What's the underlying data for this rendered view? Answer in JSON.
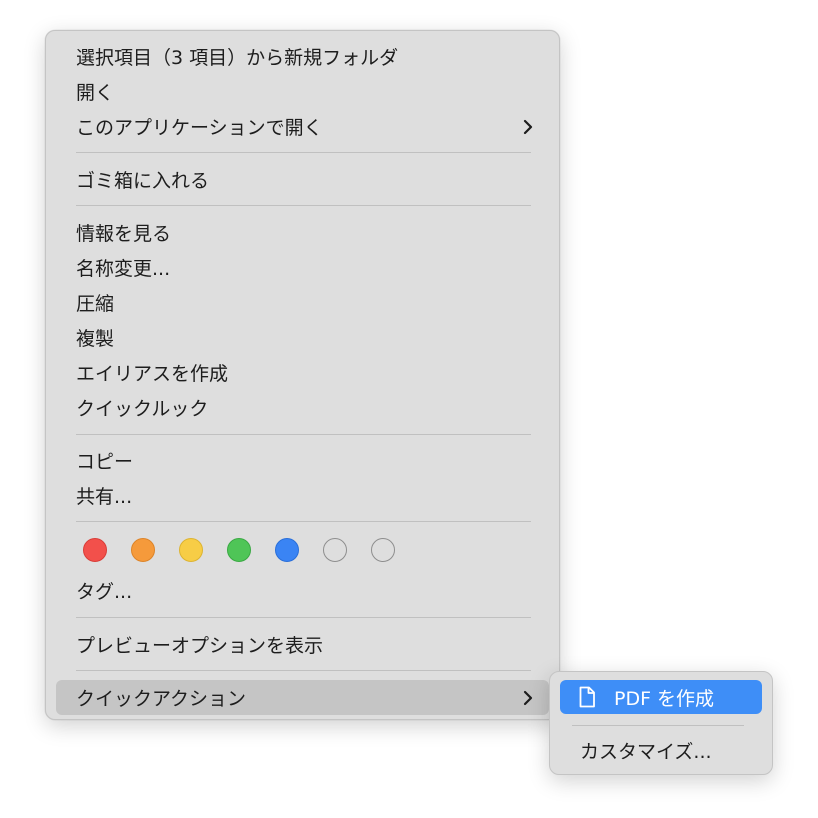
{
  "context_menu": {
    "items": [
      {
        "label": "選択項目（3 項目）から新規フォルダ"
      },
      {
        "label": "開く"
      },
      {
        "label": "このアプリケーションで開く"
      },
      {
        "label": "ゴミ箱に入れる"
      },
      {
        "label": "情報を見る"
      },
      {
        "label": "名称変更..."
      },
      {
        "label": "圧縮"
      },
      {
        "label": "複製"
      },
      {
        "label": "エイリアスを作成"
      },
      {
        "label": "クイックルック"
      },
      {
        "label": "コピー"
      },
      {
        "label": "共有..."
      },
      {
        "label": "タグ..."
      },
      {
        "label": "プレビューオプションを表示"
      },
      {
        "label": "クイックアクション"
      }
    ],
    "tag_colors": [
      {
        "name": "red",
        "fill": "#f2504b",
        "stroke": "#d93d38"
      },
      {
        "name": "orange",
        "fill": "#f59a3b",
        "stroke": "#dd8428"
      },
      {
        "name": "yellow",
        "fill": "#f7cd46",
        "stroke": "#ddb431"
      },
      {
        "name": "green",
        "fill": "#4fc557",
        "stroke": "#3aa943"
      },
      {
        "name": "blue",
        "fill": "#3a84f4",
        "stroke": "#2a6fd9"
      },
      {
        "name": "gray-empty-1",
        "fill": "transparent",
        "stroke": "#8e8e8e"
      },
      {
        "name": "gray-empty-2",
        "fill": "transparent",
        "stroke": "#8e8e8e"
      }
    ],
    "selected_item": "クイックアクション"
  },
  "submenu": {
    "items": [
      {
        "label": "PDF を作成",
        "icon": "document-icon"
      },
      {
        "label": "カスタマイズ..."
      }
    ],
    "highlight_color": "#3e8ef7"
  }
}
